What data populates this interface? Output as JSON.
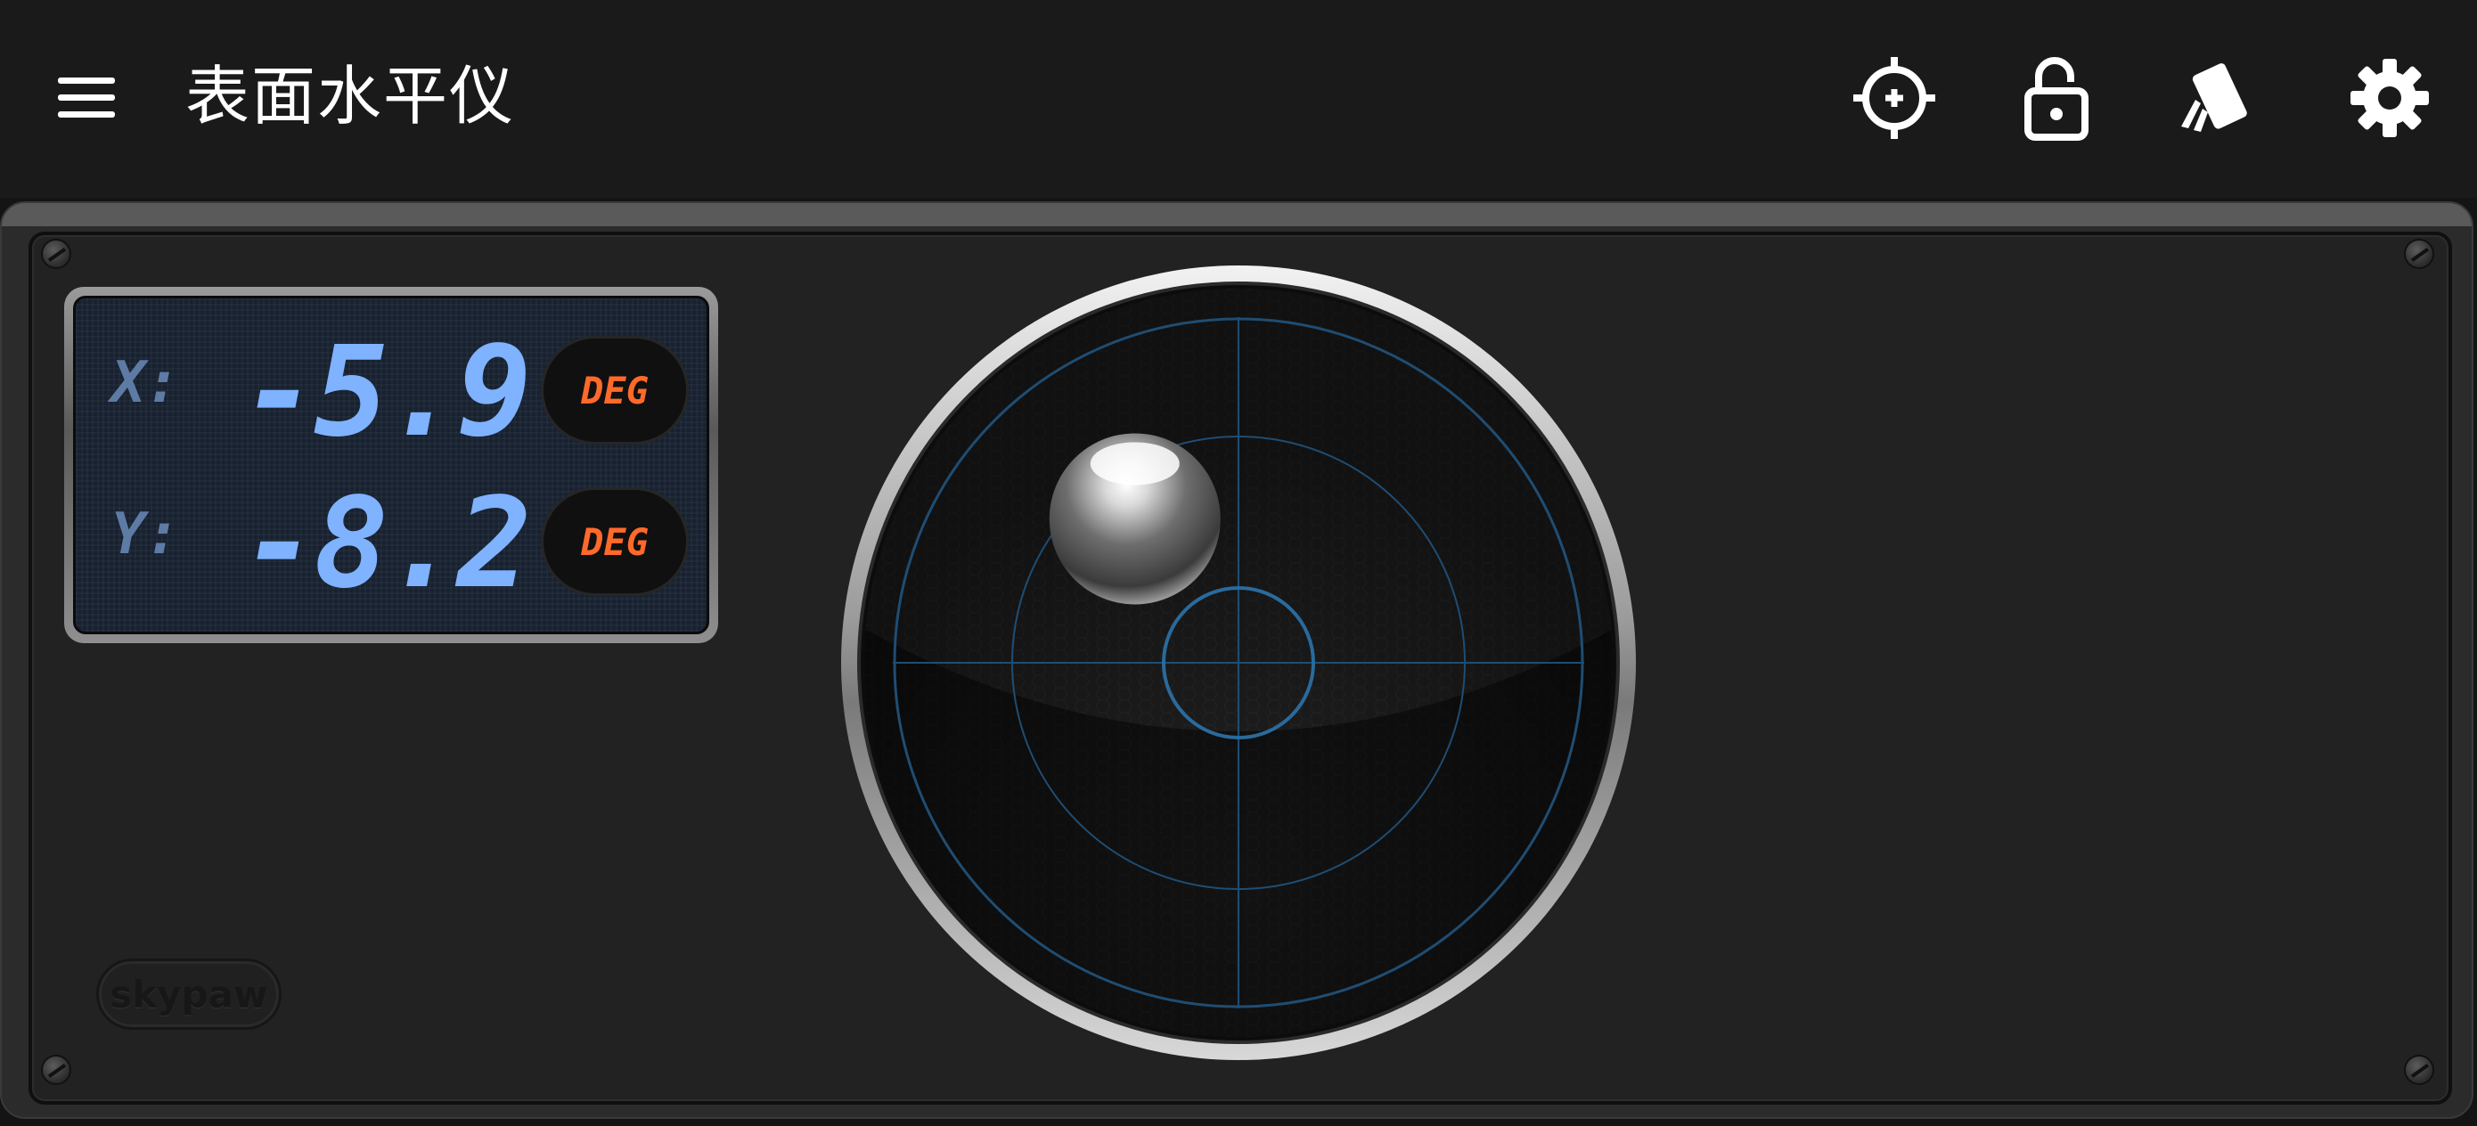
{
  "app": {
    "title": "表面水平仪"
  },
  "toolbar": {
    "menu_icon": "hamburger-menu-icon",
    "actions": [
      {
        "name": "calibrate",
        "icon": "crosshair-icon"
      },
      {
        "name": "lock",
        "icon": "unlock-icon"
      },
      {
        "name": "display-mode",
        "icon": "cards-icon"
      },
      {
        "name": "settings",
        "icon": "gear-icon"
      }
    ]
  },
  "readout": {
    "x_label": "X:",
    "x_value": "-5.9",
    "x_unit": "DEG",
    "y_label": "Y:",
    "y_value": "-8.2",
    "y_unit": "DEG"
  },
  "bubble": {
    "x_deg": -5.9,
    "y_deg": -8.2
  },
  "brand": {
    "logo_text": "skypaw"
  },
  "colors": {
    "lcd_value": "#7fb2ff",
    "lcd_label": "#5d7ba4",
    "unit": "#ff6a2a",
    "dial_grid": "#1f4d73"
  }
}
